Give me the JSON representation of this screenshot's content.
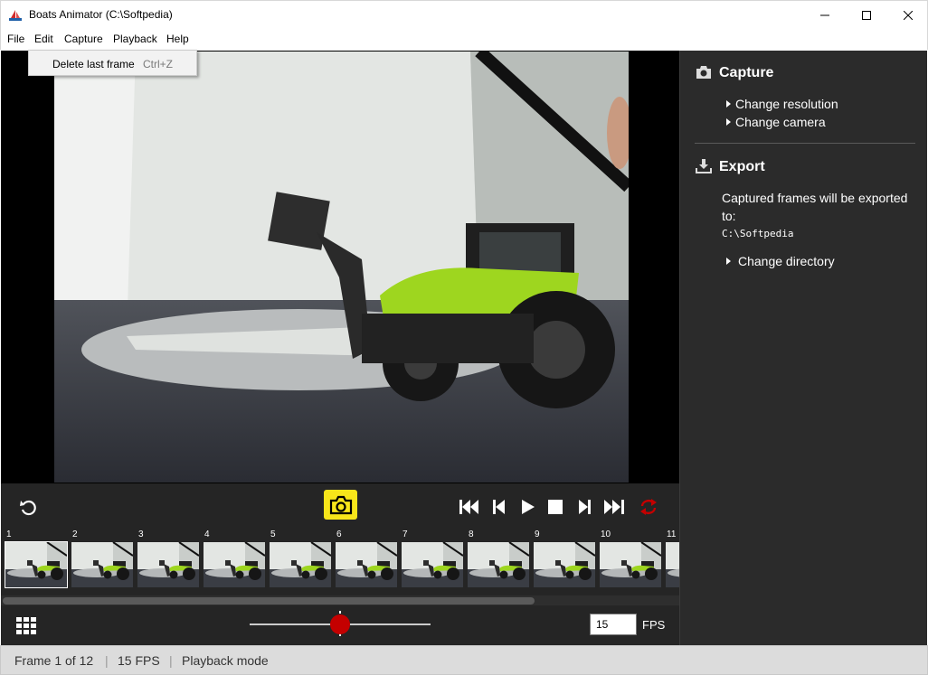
{
  "window": {
    "title": "Boats Animator (C:\\Softpedia)"
  },
  "menu": {
    "items": [
      "File",
      "Edit",
      "Capture",
      "Playback",
      "Help"
    ],
    "dropdown": {
      "label": "Delete last frame",
      "shortcut": "Ctrl+Z"
    }
  },
  "controls": {
    "icons": [
      "undo-icon",
      "camera-icon",
      "skip-first-icon",
      "step-back-icon",
      "play-icon",
      "stop-icon",
      "step-forward-icon",
      "skip-last-icon",
      "loop-icon"
    ],
    "loop_color": "#c40000",
    "capture_color": "#f7e51a"
  },
  "frames": [
    "1",
    "2",
    "3",
    "4",
    "5",
    "6",
    "7",
    "8",
    "9",
    "10",
    "11"
  ],
  "fps_field": {
    "value": "15",
    "label": "FPS"
  },
  "onion_slider": {
    "value": 0.5
  },
  "side_panel": {
    "capture": {
      "title": "Capture",
      "links": [
        "Change resolution",
        "Change camera"
      ]
    },
    "export": {
      "title": "Export",
      "text": "Captured frames will be exported to:",
      "directory": "C:\\Softpedia",
      "link": "Change directory"
    }
  },
  "status_bar": {
    "frame": "Frame 1 of 12",
    "fps": "15 FPS",
    "mode": "Playback mode",
    "separator": "|"
  }
}
